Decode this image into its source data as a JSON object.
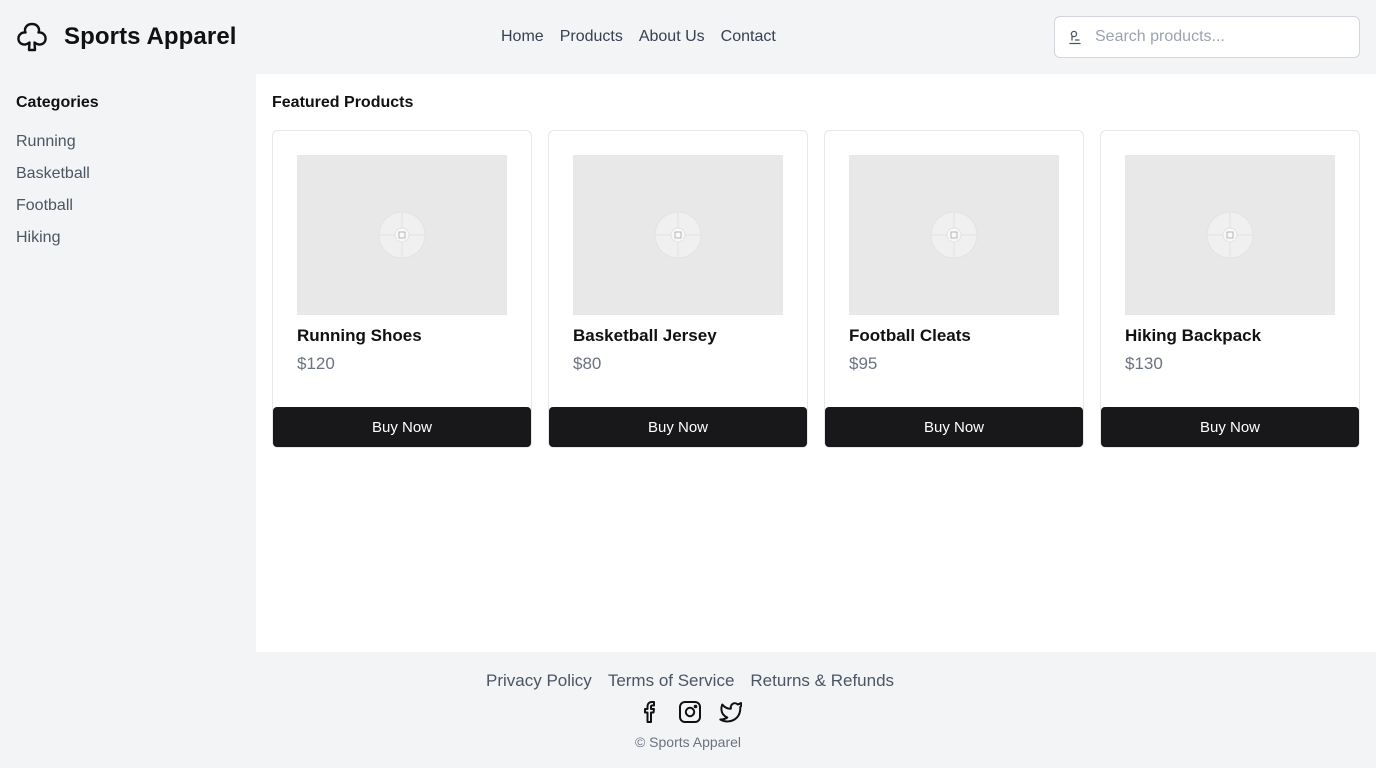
{
  "brand": {
    "title": "Sports Apparel",
    "logo_icon": "cloud-icon"
  },
  "nav": {
    "items": [
      "Home",
      "Products",
      "About Us",
      "Contact"
    ]
  },
  "search": {
    "placeholder": "Search products...",
    "value": "",
    "icon": "search-icon"
  },
  "sidebar": {
    "heading": "Categories",
    "items": [
      "Running",
      "Basketball",
      "Football",
      "Hiking"
    ]
  },
  "main": {
    "heading": "Featured Products",
    "products": [
      {
        "name": "Running Shoes",
        "price": "$120",
        "button": "Buy Now"
      },
      {
        "name": "Basketball Jersey",
        "price": "$80",
        "button": "Buy Now"
      },
      {
        "name": "Football Cleats",
        "price": "$95",
        "button": "Buy Now"
      },
      {
        "name": "Hiking Backpack",
        "price": "$130",
        "button": "Buy Now"
      }
    ]
  },
  "footer": {
    "links": [
      "Privacy Policy",
      "Terms of Service",
      "Returns & Refunds"
    ],
    "social_icons": [
      "facebook-icon",
      "instagram-icon",
      "twitter-icon"
    ],
    "copyright": "© Sports Apparel"
  },
  "colors": {
    "background": "#f3f4f6",
    "surface": "#ffffff",
    "button": "#18181b",
    "muted_text": "#6b7280",
    "placeholder": "#e8e8e8"
  }
}
